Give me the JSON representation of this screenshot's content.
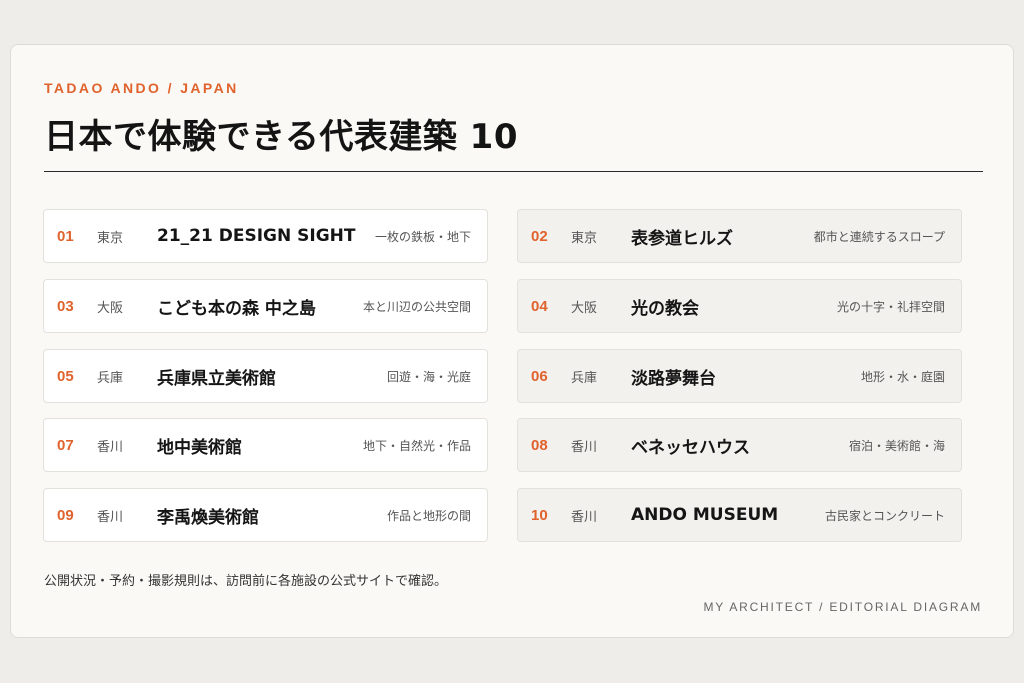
{
  "header": {
    "eyebrow": "TADAO ANDO / JAPAN",
    "title": "日本で体験できる代表建築 10"
  },
  "items": [
    {
      "num": "01",
      "pref": "東京",
      "name": "21_21 DESIGN SIGHT",
      "note": "一枚の鉄板・地下"
    },
    {
      "num": "02",
      "pref": "東京",
      "name": "表参道ヒルズ",
      "note": "都市と連続するスロープ"
    },
    {
      "num": "03",
      "pref": "大阪",
      "name": "こども本の森 中之島",
      "note": "本と川辺の公共空間"
    },
    {
      "num": "04",
      "pref": "大阪",
      "name": "光の教会",
      "note": "光の十字・礼拝空間"
    },
    {
      "num": "05",
      "pref": "兵庫",
      "name": "兵庫県立美術館",
      "note": "回遊・海・光庭"
    },
    {
      "num": "06",
      "pref": "兵庫",
      "name": "淡路夢舞台",
      "note": "地形・水・庭園"
    },
    {
      "num": "07",
      "pref": "香川",
      "name": "地中美術館",
      "note": "地下・自然光・作品"
    },
    {
      "num": "08",
      "pref": "香川",
      "name": "ベネッセハウス",
      "note": "宿泊・美術館・海"
    },
    {
      "num": "09",
      "pref": "香川",
      "name": "李禹煥美術館",
      "note": "作品と地形の間"
    },
    {
      "num": "10",
      "pref": "香川",
      "name": "ANDO MUSEUM",
      "note": "古民家とコンクリート"
    }
  ],
  "footer": {
    "note": "公開状況・予約・撮影規則は、訪問前に各施設の公式サイトで確認。",
    "credit": "MY ARCHITECT / EDITORIAL DIAGRAM"
  }
}
